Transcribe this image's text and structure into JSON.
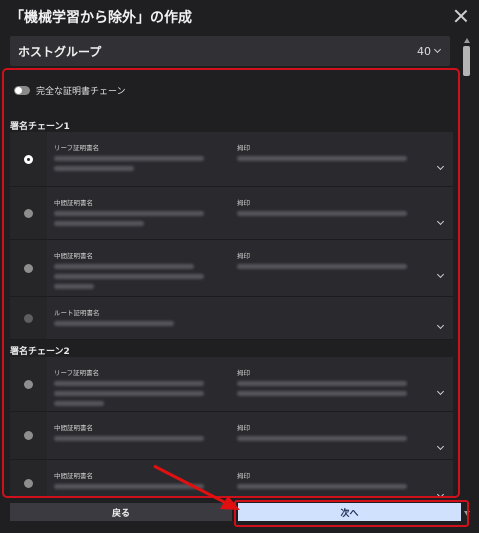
{
  "dialog": {
    "title": "「機械学習から除外」の作成"
  },
  "hostgroup": {
    "label": "ホストグループ",
    "count": "40"
  },
  "toggle": {
    "label": "完全な証明書チェーン"
  },
  "chains": [
    {
      "label": "署名チェーン1",
      "rows": [
        {
          "name_header": "リーフ証明書名",
          "fp_header": "拇印",
          "selected": true
        },
        {
          "name_header": "中間証明書名",
          "fp_header": "拇印",
          "selected": false
        },
        {
          "name_header": "中間証明書名",
          "fp_header": "拇印",
          "selected": false
        },
        {
          "name_header": "ルート証明書名",
          "fp_header": "",
          "selected": false
        }
      ]
    },
    {
      "label": "署名チェーン2",
      "rows": [
        {
          "name_header": "リーフ証明書名",
          "fp_header": "拇印",
          "selected": false
        },
        {
          "name_header": "中間証明書名",
          "fp_header": "拇印",
          "selected": false
        },
        {
          "name_header": "中間証明書名",
          "fp_header": "拇印",
          "selected": false
        }
      ]
    }
  ],
  "footer": {
    "back_label": "戻る",
    "next_label": "次へ"
  },
  "colors": {
    "highlight": "#d0101a",
    "primary_button": "#cfe1fd"
  }
}
